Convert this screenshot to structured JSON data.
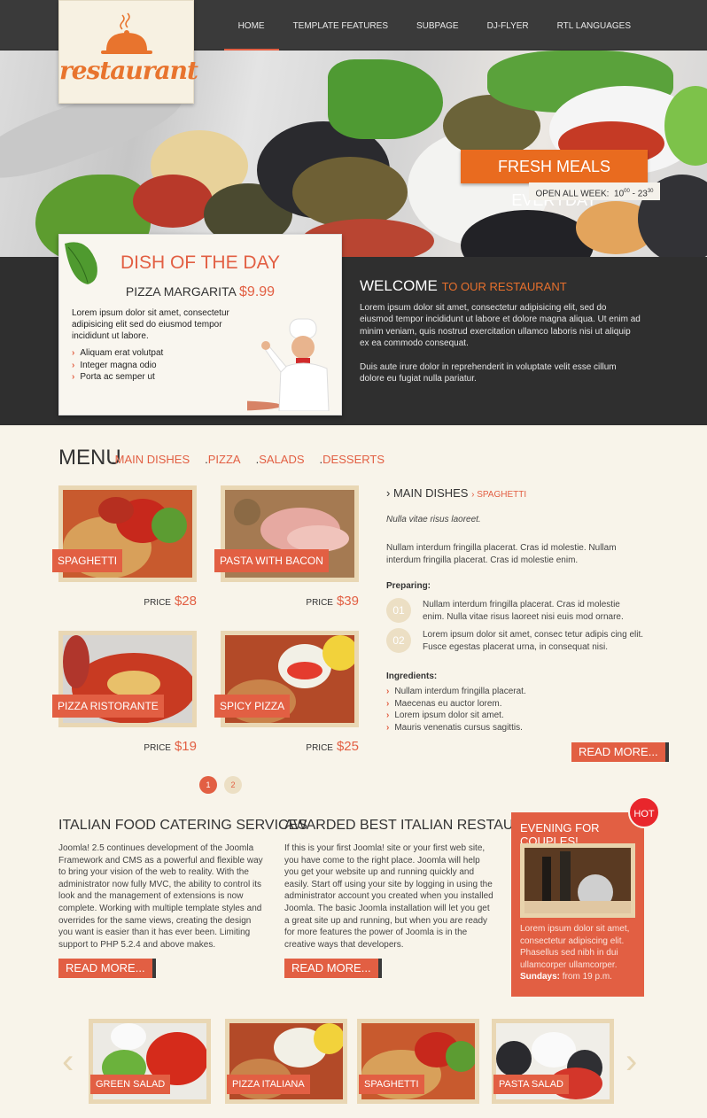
{
  "nav": [
    "HOME",
    "TEMPLATE FEATURES",
    "SUBPAGE",
    "DJ-FLYER",
    "RTL LANGUAGES"
  ],
  "logo": {
    "text": "restaurant"
  },
  "hero": {
    "fresh": "FRESH MEALS EVERYDAY",
    "open_label": "OPEN ALL WEEK:",
    "open_from": "10",
    "open_from_sup": "00",
    "open_sep": " - ",
    "open_to": "23",
    "open_to_sup": "30"
  },
  "dish": {
    "title": "DISH OF THE DAY",
    "name": "PIZZA MARGARITA",
    "price": "$9.99",
    "desc": "Lorem ipsum dolor sit amet, consectetur adipisicing elit sed do eiusmod tempor incididunt ut labore.",
    "list": [
      "Aliquam erat volutpat",
      "Integer magna odio",
      "Porta ac semper ut"
    ]
  },
  "welcome": {
    "title": "WELCOME",
    "title_accent": "TO OUR RESTAURANT",
    "p1": "Lorem ipsum dolor sit amet, consectetur adipisicing elit, sed do eiusmod tempor incididunt ut labore et dolore magna aliqua. Ut enim ad minim veniam, quis nostrud exercitation ullamco laboris nisi ut aliquip ex ea commodo consequat.",
    "p2": "Duis aute irure dolor in reprehenderit in voluptate velit esse cillum dolore eu fugiat nulla pariatur."
  },
  "menu": {
    "heading": "MENU",
    "tabs": [
      "MAIN DISHES",
      "PIZZA",
      "SALADS",
      "DESSERTS"
    ],
    "price_label": "PRICE",
    "items": [
      {
        "name": "SPAGHETTI",
        "price": "$28"
      },
      {
        "name": "PASTA WITH BACON",
        "price": "$39"
      },
      {
        "name": "PIZZA RISTORANTE",
        "price": "$19"
      },
      {
        "name": "SPICY PIZZA",
        "price": "$25"
      }
    ],
    "pages": [
      "1",
      "2"
    ]
  },
  "main_dishes": {
    "title": "MAIN DISHES",
    "crumb": "SPAGHETTI",
    "italic": "Nulla vitae risus laoreet.",
    "para": "Nullam interdum fringilla placerat. Cras id molestie. Nullam interdum fringilla placerat. Cras id molestie enim.",
    "preparing_label": "Preparing:",
    "steps": [
      {
        "num": "01",
        "text": "Nullam interdum fringilla placerat. Cras id molestie enim. Nulla vitae risus laoreet nisi euis mod ornare."
      },
      {
        "num": "02",
        "text": "Lorem ipsum dolor sit amet, consec tetur adipis cing elit. Fusce egestas placerat urna, in consequat nisi."
      }
    ],
    "ingredients_label": "Ingredients:",
    "ingredients": [
      "Nullam interdum fringilla placerat.",
      "Maecenas eu auctor lorem.",
      "Lorem ipsum dolor sit amet.",
      "Mauris venenatis cursus sagittis."
    ],
    "read_more": "READ MORE..."
  },
  "catering": {
    "title": "ITALIAN FOOD CATERING SERVICES",
    "text": "Joomla! 2.5 continues development of the Joomla Framework and CMS as a powerful and flexible way to bring your vision of the web to reality. With the administrator now fully MVC, the ability to control its look and the management of extensions is now complete. Working with multiple template styles and overrides for the same views, creating the design you want is easier than it has ever been. Limiting support to PHP 5.2.4 and above makes.",
    "read_more": "READ MORE..."
  },
  "awarded": {
    "title": "AWARDED BEST ITALIAN RESTAURANT",
    "text": "If this is your first Joomla! site or your first web site, you have come to the right place. Joomla will help you get your website up and running quickly and easily. Start off using your site by logging in using the administrator account you created when you installed Joomla. The basic Joomla installation will let you get a great site up and running, but when you are ready for more features the power of Joomla is in the creative ways that developers.",
    "read_more": "READ MORE..."
  },
  "couples": {
    "title": "EVENING FOR COUPLES!",
    "badge": "HOT",
    "text": "Lorem ipsum dolor sit amet, consectetur adipiscing elit. Phasellus sed nibh in dui ullamcorper ullamcorper.",
    "sundays_label": "Sundays:",
    "sundays_value": "from 19 p.m."
  },
  "carousel": [
    "GREEN SALAD",
    "PIZZA ITALIANA",
    "SPAGHETTI",
    "PASTA SALAD"
  ],
  "colors": {
    "accent": "#e25f43",
    "orange": "#e96b1f",
    "dark": "#3a3a3a",
    "cream": "#f8f4ea"
  }
}
